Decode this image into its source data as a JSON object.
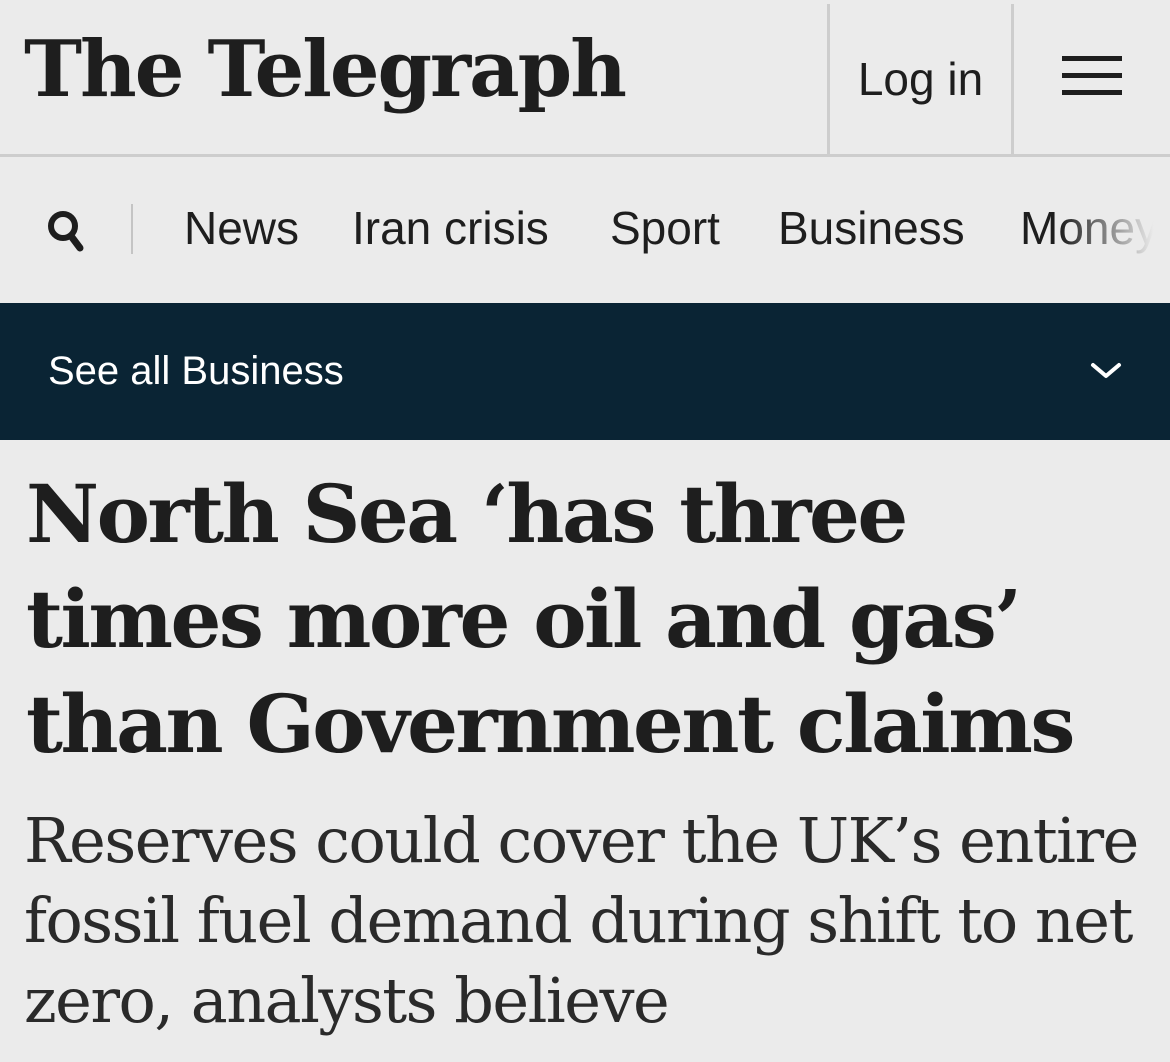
{
  "masthead": {
    "logo_text": "The Telegraph",
    "login_label": "Log in",
    "menu_icon": "hamburger-menu-icon"
  },
  "nav": {
    "search_icon": "search-icon",
    "items": [
      {
        "label": "News"
      },
      {
        "label": "Iran crisis"
      },
      {
        "label": "Sport"
      },
      {
        "label": "Business"
      },
      {
        "label": "Money"
      }
    ]
  },
  "subnav": {
    "label": "See all Business",
    "icon": "chevron-down-icon",
    "background": "#0a2434"
  },
  "article": {
    "headline": "North Sea ‘has three times more oil and gas’ than Government claims",
    "standfirst": "Reserves could cover the UK’s entire fossil fuel demand during shift to net zero, analysts believe"
  },
  "colors": {
    "page_background": "#ebebeb",
    "text": "#1e1e1e",
    "divider": "#cdcdcd"
  }
}
